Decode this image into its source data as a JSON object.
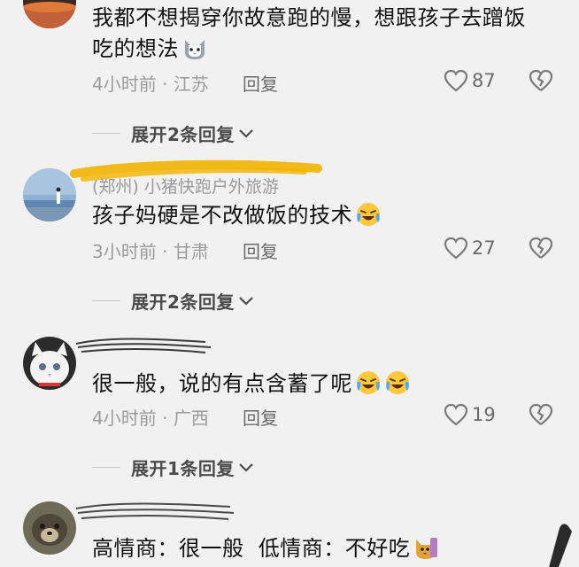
{
  "comments": [
    {
      "text": "我都不想揭穿你故意跑的慢，想跟孩子去蹭饭吃的想法",
      "emoji": "cat-face-emoji",
      "time": "4小时前",
      "location": "江苏",
      "reply_label": "回复",
      "likes": "87",
      "expand_label": "展开2条回复"
    },
    {
      "username": "(郑州) 小猪快跑户外旅游",
      "text": "孩子妈硬是不改做饭的技术",
      "emoji": "laughing-crying-emoji",
      "time": "3小时前",
      "location": "甘肃",
      "reply_label": "回复",
      "likes": "27",
      "expand_label": "展开2条回复"
    },
    {
      "text": "很一般，说的有点含蓄了呢",
      "emoji": "laughing-crying-emoji",
      "time": "4小时前",
      "location": "广西",
      "reply_label": "回复",
      "likes": "19",
      "expand_label": "展开1条回复"
    },
    {
      "text": "高情商：很一般  低情商：不好吃",
      "emoji": "cat-face-emoji"
    }
  ],
  "separator": " · ",
  "colors": {
    "background": "#f1f1f1",
    "text": "#111111",
    "meta": "#9b9b9b",
    "highlight": "#f2b400"
  }
}
